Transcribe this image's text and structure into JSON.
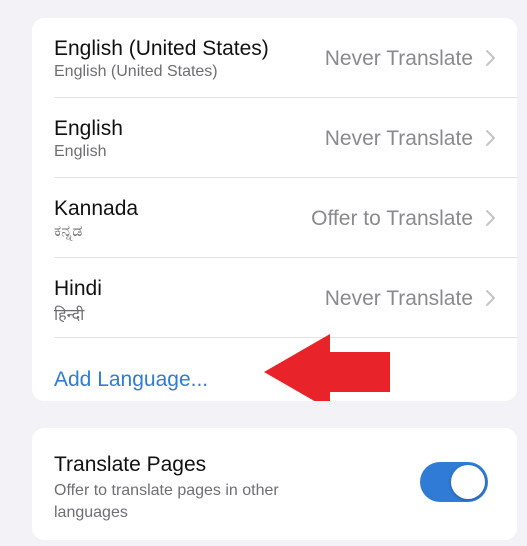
{
  "languages": [
    {
      "name": "English (United States)",
      "native": "English (United States)",
      "setting": "Never Translate"
    },
    {
      "name": "English",
      "native": "English",
      "setting": "Never Translate"
    },
    {
      "name": "Kannada",
      "native": "ಕನ್ನಡ",
      "setting": "Offer to Translate"
    },
    {
      "name": "Hindi",
      "native": "हिन्दी",
      "setting": "Never Translate"
    }
  ],
  "add_language_label": "Add Language...",
  "translate_pages": {
    "title": "Translate Pages",
    "description": "Offer to translate pages in other languages",
    "enabled": true
  },
  "colors": {
    "accent": "#2f7bd6",
    "annotation_arrow": "#e8232a"
  }
}
